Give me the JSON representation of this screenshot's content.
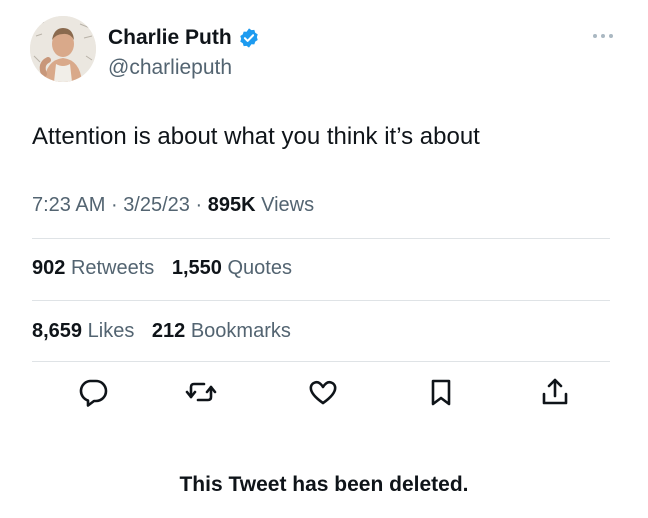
{
  "author": {
    "display_name": "Charlie Puth",
    "handle": "@charlieputh"
  },
  "tweet": {
    "text": "Attention is about what you think it’s about",
    "time": "7:23 AM",
    "date": "3/25/23",
    "views_count": "895K",
    "views_label": "Views",
    "separator": "·"
  },
  "stats": {
    "retweets_count": "902",
    "retweets_label": "Retweets",
    "quotes_count": "1,550",
    "quotes_label": "Quotes",
    "likes_count": "8,659",
    "likes_label": "Likes",
    "bookmarks_count": "212",
    "bookmarks_label": "Bookmarks"
  },
  "icons": {
    "verified": "verified-badge-icon",
    "more": "more-icon",
    "reply": "reply-icon",
    "retweet": "retweet-icon",
    "like": "like-icon",
    "bookmark": "bookmark-icon",
    "share": "share-icon"
  },
  "colors": {
    "verified_blue": "#1d9bf0",
    "text_primary": "#0f1419",
    "text_secondary": "#536471",
    "divider": "#dfe3e6"
  },
  "footer": {
    "deleted_message": "This Tweet has been deleted."
  }
}
